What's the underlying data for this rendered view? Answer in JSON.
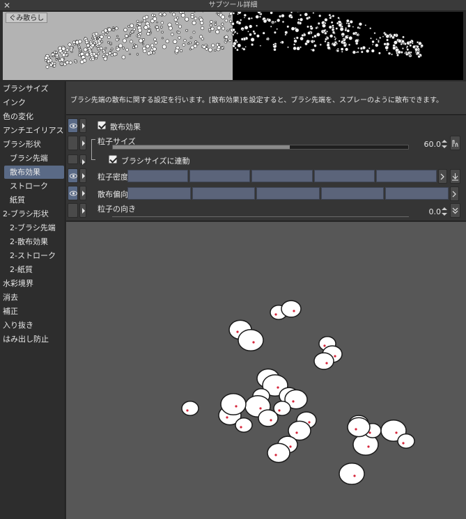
{
  "window": {
    "title": "サブツール詳細",
    "close_glyph": "✕"
  },
  "preview": {
    "brush_name": "ぐみ散らし"
  },
  "sidebar": {
    "items": [
      {
        "label": "ブラシサイズ",
        "sub": false,
        "active": false
      },
      {
        "label": "インク",
        "sub": false,
        "active": false
      },
      {
        "label": "色の変化",
        "sub": false,
        "active": false
      },
      {
        "label": "アンチエイリアス",
        "sub": false,
        "active": false
      },
      {
        "label": "ブラシ形状",
        "sub": false,
        "active": false
      },
      {
        "label": "ブラシ先端",
        "sub": true,
        "active": false
      },
      {
        "label": "散布効果",
        "sub": true,
        "active": true
      },
      {
        "label": "ストローク",
        "sub": true,
        "active": false
      },
      {
        "label": "紙質",
        "sub": true,
        "active": false
      },
      {
        "label": "2-ブラシ形状",
        "sub": false,
        "active": false
      },
      {
        "label": "2-ブラシ先端",
        "sub": true,
        "active": false
      },
      {
        "label": "2-散布効果",
        "sub": true,
        "active": false
      },
      {
        "label": "2-ストローク",
        "sub": true,
        "active": false
      },
      {
        "label": "2-紙質",
        "sub": true,
        "active": false
      },
      {
        "label": "水彩境界",
        "sub": false,
        "active": false
      },
      {
        "label": "消去",
        "sub": false,
        "active": false
      },
      {
        "label": "補正",
        "sub": false,
        "active": false
      },
      {
        "label": "入り抜き",
        "sub": false,
        "active": false
      },
      {
        "label": "はみ出し防止",
        "sub": false,
        "active": false
      }
    ]
  },
  "description": "ブラシ先端の散布に関する設定を行います。[散布効果]を設定すると、ブラシ先端を、スプレーのように散布できます。",
  "settings": {
    "scatter_effect": {
      "label": "散布効果",
      "checked": true
    },
    "particle_size": {
      "label": "粒子サイズ",
      "value": "60.0",
      "fill_pct": 60
    },
    "link_brush_size": {
      "label": "ブラシサイズに連動",
      "checked": true
    },
    "particle_density": {
      "label": "粒子密度",
      "segments": 5
    },
    "scatter_bias": {
      "label": "散布偏向",
      "segments": 5
    },
    "particle_direction": {
      "label": "粒子の向き",
      "value": "0.0"
    }
  },
  "colors": {
    "accent": "#5a6a86",
    "canvas_bg": "#575757",
    "preview_left": "#b3b3b3",
    "preview_right": "#000000",
    "particle_fill": "#ffffff",
    "particle_accent": "#d6253a"
  }
}
